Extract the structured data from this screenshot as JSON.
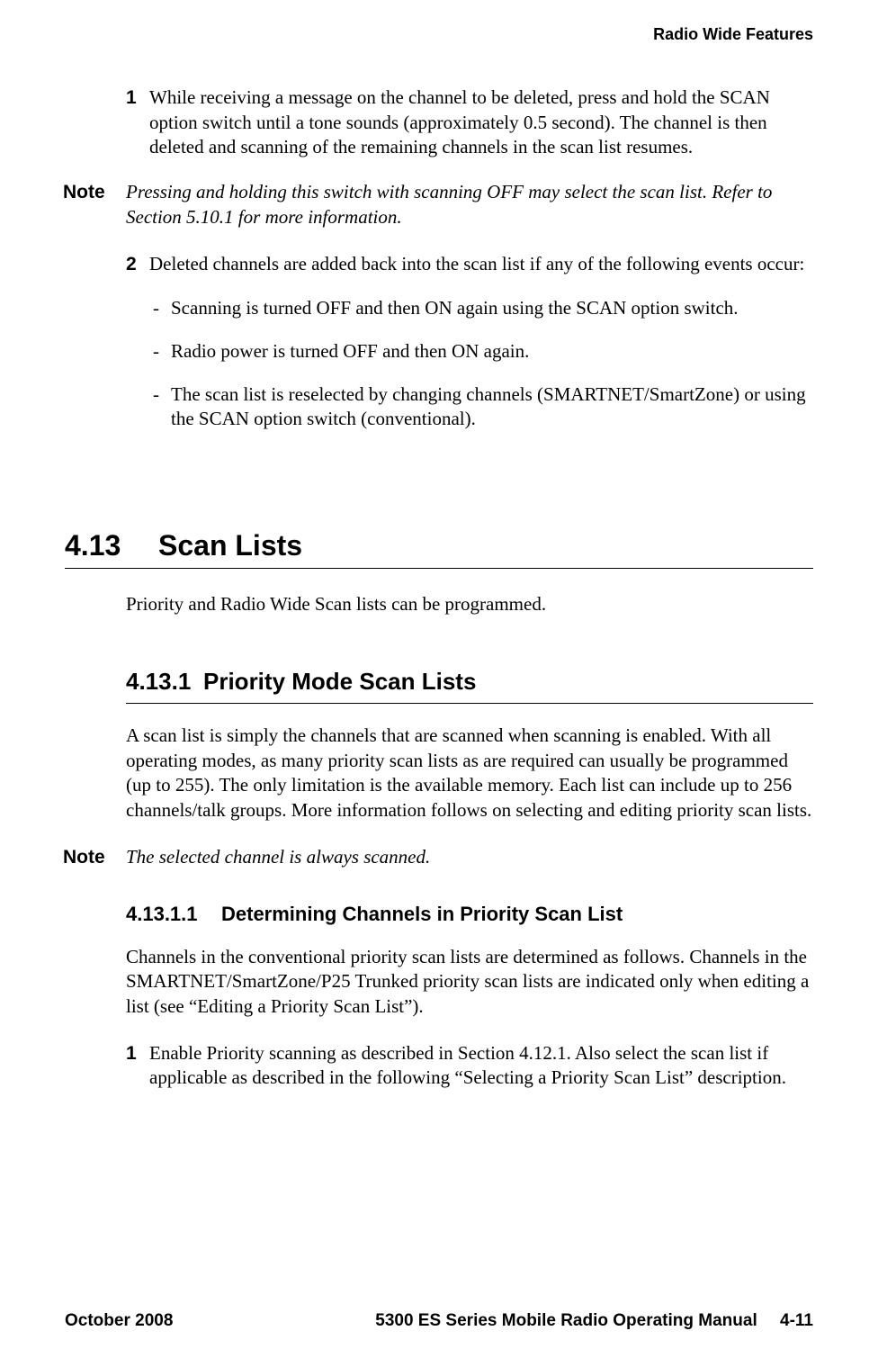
{
  "header": {
    "running_head": "Radio Wide Features"
  },
  "steps": {
    "n1": "1",
    "t1": "While receiving a message on the channel to be deleted, press and hold the SCAN option switch until a tone sounds (approximately 0.5 second). The channel is then deleted and scanning of the remaining channels in the scan list resumes.",
    "n2": "2",
    "t2": "Deleted channels are added back into the scan list if any of the following events occur:"
  },
  "note1": {
    "label": "Note",
    "text": "Pressing and holding this switch with scanning OFF may select the scan list. Refer to Section 5.10.1 for more information."
  },
  "bullets": {
    "b1": "Scanning is turned OFF and then ON again using the SCAN option switch.",
    "b2": "Radio power is turned OFF and then ON again.",
    "b3": "The scan list is reselected by changing channels (SMARTNET/SmartZone) or using the SCAN option switch (conventional)."
  },
  "h1": {
    "num": "4.13",
    "title": "Scan Lists",
    "intro": "Priority and Radio Wide Scan lists can be programmed."
  },
  "h2": {
    "num": "4.13.1",
    "title": "Priority Mode Scan Lists",
    "para": "A scan list is simply the channels that are scanned when scanning is enabled. With all operating modes, as many priority scan lists as are required can usually be programmed (up to 255). The only limitation is the available memory. Each list can include up to 256 channels/talk groups. More information follows on selecting and editing priority scan lists."
  },
  "note2": {
    "label": "Note",
    "text": "The selected channel is always scanned."
  },
  "h3": {
    "num": "4.13.1.1",
    "title": "Determining Channels in Priority Scan List",
    "para": "Channels in the conventional priority scan lists are determined as follows. Channels in the SMARTNET/SmartZone/P25 Trunked priority scan lists are indicated only when editing a list (see “Editing a Priority Scan List”).",
    "step1_num": "1",
    "step1_txt": "Enable Priority scanning as described in Section 4.12.1. Also select the scan list if applicable as described in the following “Selecting a Priority Scan List” description."
  },
  "footer": {
    "left": "October 2008",
    "manual": "5300 ES Series Mobile Radio Operating Manual",
    "page": "4-11"
  }
}
